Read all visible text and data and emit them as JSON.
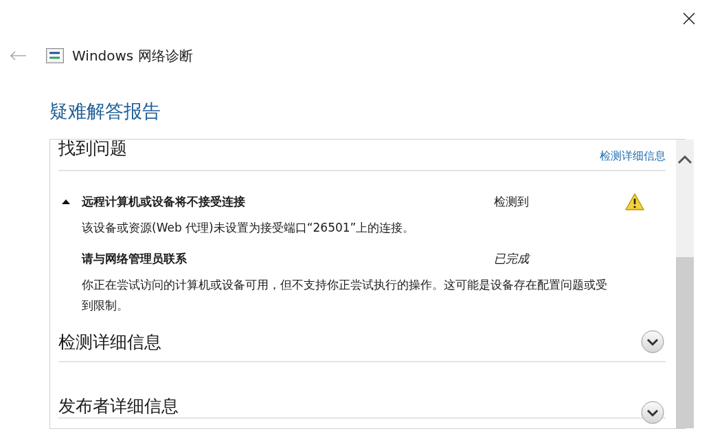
{
  "window": {
    "title": "Windows 网络诊断"
  },
  "heading": "疑难解答报告",
  "report": {
    "title": "找到问题",
    "link": "检测详细信息",
    "issues": [
      {
        "kind": "problem",
        "title": "远程计算机或设备将不接受连接",
        "status": "检测到",
        "expanded": true,
        "description": "该设备或资源(Web 代理)未设置为接受端口“26501”上的连接。"
      },
      {
        "kind": "action",
        "title": "请与网络管理员联系",
        "status": "已完成",
        "description": "你正在尝试访问的计算机或设备可用，但不支持你正尝试执行的操作。这可能是设备存在配置问题或受到限制。"
      }
    ],
    "sections": [
      {
        "title": "检测详细信息",
        "expanded": false
      },
      {
        "title": "发布者详细信息",
        "expanded": false
      }
    ]
  }
}
